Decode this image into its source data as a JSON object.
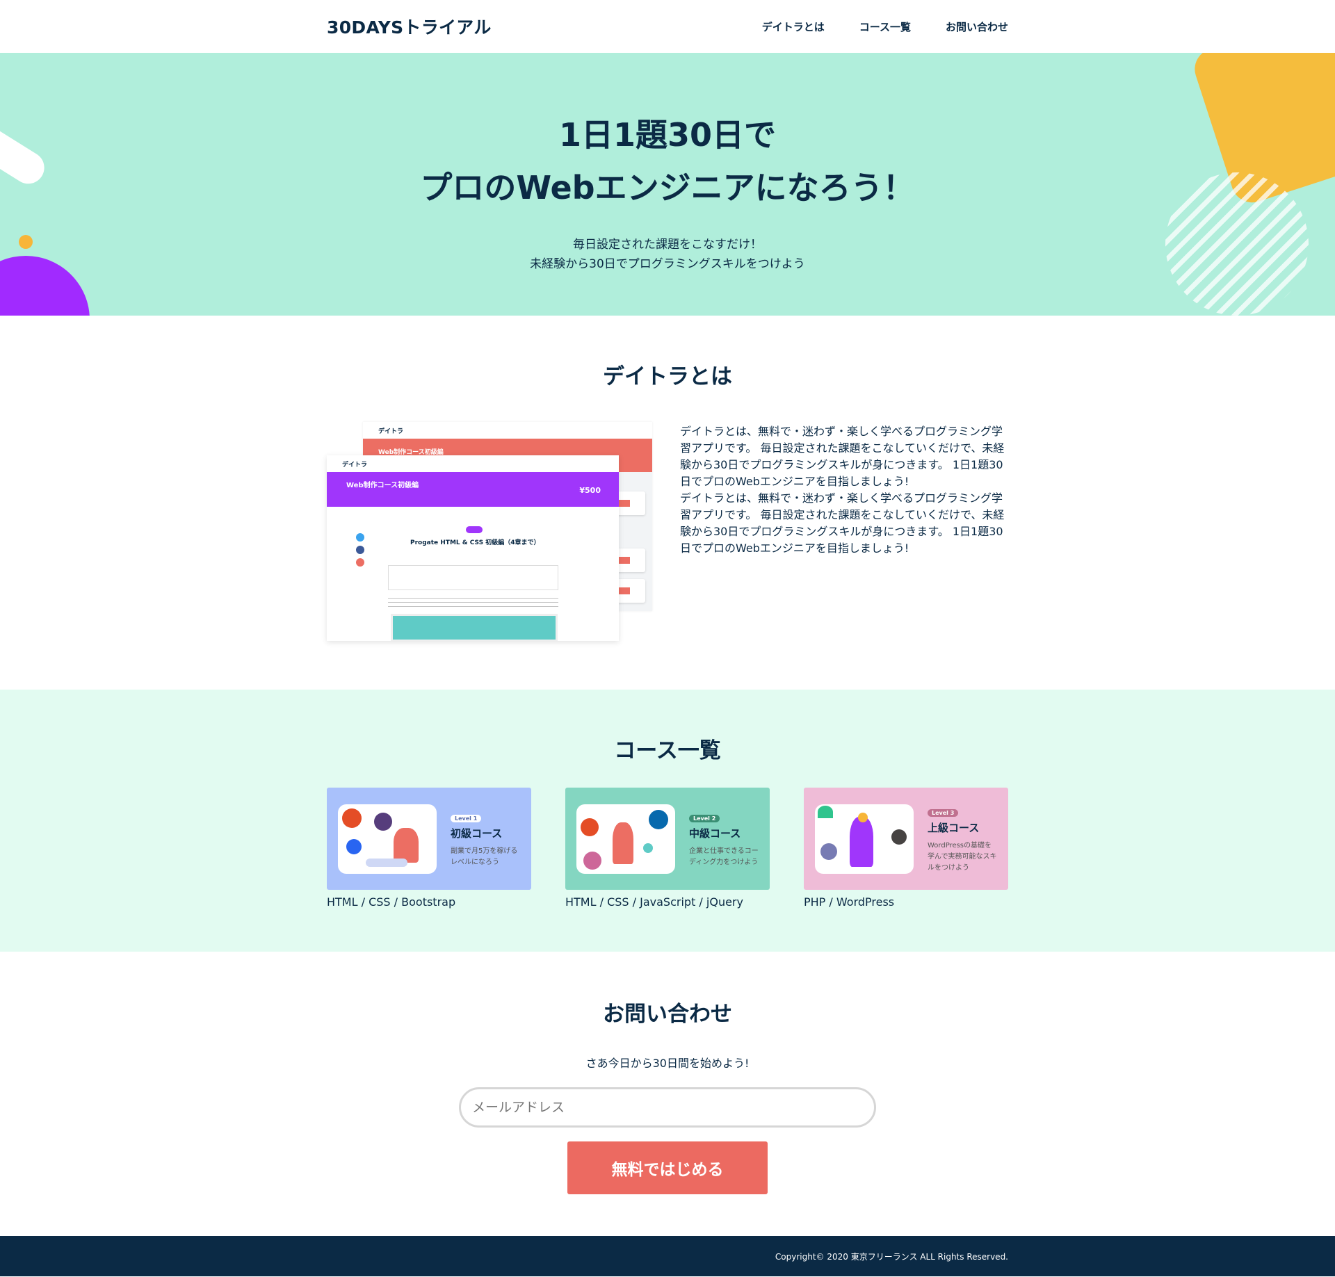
{
  "header": {
    "logo": "30DAYSトライアル",
    "nav": [
      "デイトラとは",
      "コース一覧",
      "お問い合わせ"
    ]
  },
  "hero": {
    "title_line1": "1日1題30日で",
    "title_line2": "プロのWebエンジニアになろう！",
    "lead_line1": "毎日設定された課題をこなすだけ！",
    "lead_line2": "未経験から30日でプログラミングスキルをつけよう"
  },
  "about": {
    "title": "デイトラとは",
    "paragraph1": "デイトラとは、無料で・迷わず・楽しく学べるプログラミング学習アプリです。 毎日設定された課題をこなしていくだけで、未経験から30日でプログラミングスキルが身につきます。 1日1題30日でプロのWebエンジニアを目指しましょう!",
    "paragraph2": "デイトラとは、無料で・迷わず・楽しく学べるプログラミング学習アプリです。 毎日設定された課題をこなしていくだけで、未経験から30日でプログラミングスキルが身につきます。 1日1題30日でプロのWebエンジニアを目指しましょう!",
    "screenshot": {
      "brand": "デイトラ",
      "back_title": "Web制作コース初級編",
      "front_title": "Web制作コース初級編",
      "front_price": "¥500",
      "lesson_title": "Progate HTML & CSS 初級編（4章まで）"
    }
  },
  "courses": {
    "title": "コース一覧",
    "items": [
      {
        "level": "Level 1",
        "name": "初級コース",
        "desc": "副業で月5万を稼げるレベルになろう",
        "tags": "HTML / CSS / Bootstrap",
        "bg": "#a9c1fb",
        "level_color": "#ffffff"
      },
      {
        "level": "Level 2",
        "name": "中級コース",
        "desc": "企業と仕事できるコーディング力をつけよう",
        "tags": "HTML / CSS / JavaScript / jQuery",
        "bg": "#84d6c1",
        "level_color": "#3a8f74"
      },
      {
        "level": "Level 3",
        "name": "上級コース",
        "desc": "WordPressの基礎を学んで実務可能なスキルをつけよう",
        "tags": "PHP / WordPress",
        "bg": "#efbcd7",
        "level_color": "#c0708f"
      }
    ]
  },
  "contact": {
    "title": "お問い合わせ",
    "sub": "さあ今日から30日間を始めよう!",
    "email_placeholder": "メールアドレス",
    "button": "無料ではじめる"
  },
  "footer": {
    "copyright": "Copyright© 2020 東京フリーランス ALL Rights Reserved."
  },
  "colors": {
    "navy": "#0b2a45",
    "hero_bg": "#b0eedb",
    "courses_bg": "#e2fbf1",
    "cta": "#ec6a61",
    "purple": "#a12aff",
    "yellow": "#f5bd3d"
  }
}
